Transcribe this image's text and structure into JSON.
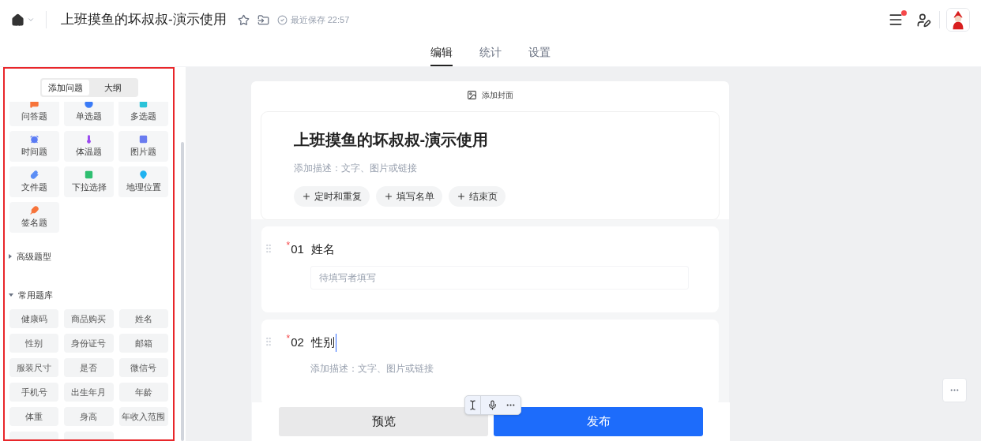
{
  "header": {
    "title": "上班摸鱼的坏叔叔-演示使用",
    "save_status": "最近保存 22:57",
    "notification_dot": true
  },
  "tabs": [
    {
      "label": "编辑",
      "selected": true
    },
    {
      "label": "统计",
      "selected": false
    },
    {
      "label": "设置",
      "selected": false
    }
  ],
  "sidebar": {
    "highlighted": true,
    "segments": [
      {
        "label": "添加问题",
        "selected": true
      },
      {
        "label": "大纲",
        "selected": false
      }
    ],
    "question_types": [
      {
        "kind": "text",
        "label": "问答题",
        "color": "#f7743a"
      },
      {
        "kind": "single",
        "label": "单选题",
        "color": "#3a7bf7"
      },
      {
        "kind": "multi",
        "label": "多选题",
        "color": "#2bc3d9"
      },
      {
        "kind": "time",
        "label": "时间题",
        "color": "#5b7cf5"
      },
      {
        "kind": "temperature",
        "label": "体温题",
        "color": "#9b4bf0"
      },
      {
        "kind": "image",
        "label": "图片题",
        "color": "#6a7cf0"
      },
      {
        "kind": "file",
        "label": "文件题",
        "color": "#5b8ef5"
      },
      {
        "kind": "dropdown",
        "label": "下拉选择",
        "color": "#2fbf71"
      },
      {
        "kind": "location",
        "label": "地理位置",
        "color": "#1fb2f0"
      },
      {
        "kind": "signature",
        "label": "签名题",
        "color": "#f7743a"
      }
    ],
    "sections": [
      {
        "label": "高级题型",
        "expanded": false
      },
      {
        "label": "常用题库",
        "expanded": true
      }
    ],
    "library": [
      "健康码",
      "商品购买",
      "姓名",
      "性别",
      "身份证号",
      "邮箱",
      "服装尺寸",
      "是否",
      "微信号",
      "手机号",
      "出生年月",
      "年龄",
      "体重",
      "身高",
      "年收入范围"
    ]
  },
  "form": {
    "cover": "添加封面",
    "title": "上班摸鱼的坏叔叔-演示使用",
    "description_placeholder": "添加描述：文字、图片或链接",
    "actions": [
      "定时和重复",
      "填写名单",
      "结束页"
    ],
    "questions": [
      {
        "kind": "input",
        "required_mark": "*",
        "number": "01",
        "title": "姓名",
        "focused": false,
        "placeholder": "待填写者填写"
      },
      {
        "kind": "choice",
        "required_mark": "*",
        "number": "02",
        "title": "性别",
        "focused": true,
        "placeholder": "添加描述：文字、图片或链接"
      }
    ]
  },
  "bottom_bar": {
    "preview": "预览",
    "publish": "发布"
  }
}
